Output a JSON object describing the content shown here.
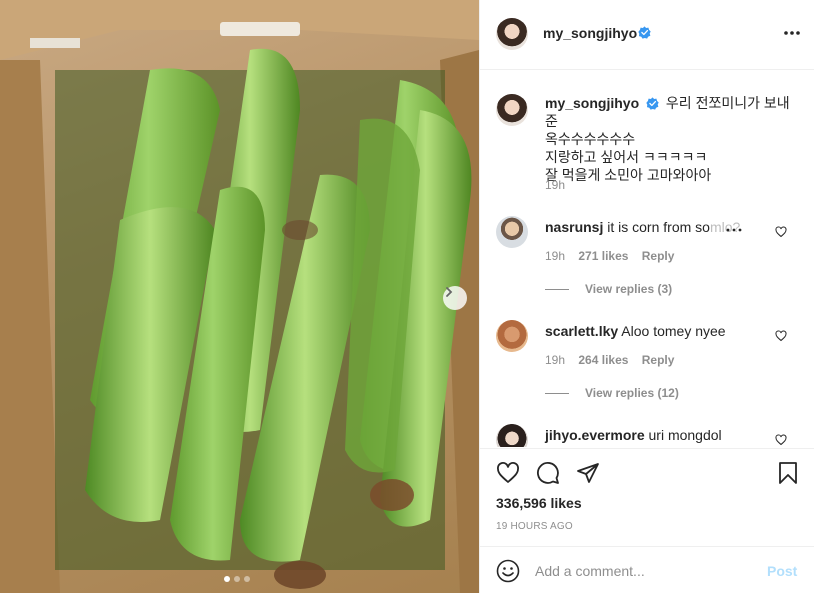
{
  "post": {
    "author": "my_songjihyo",
    "verified": true,
    "caption_lines": [
      "우리 전쪼미니가 보내준",
      "옥수수수수수수",
      "지랑하고 싶어서 ㅋㅋㅋㅋㅋ",
      "잘 먹을게 소민아 고마와아아"
    ],
    "caption_time": "19h",
    "likes": "336,596 likes",
    "posted": "19 HOURS AGO",
    "carousel": {
      "slides": 3,
      "active_slide": 1
    }
  },
  "comments": [
    {
      "username": "nasrunsj",
      "text": "it is corn from so",
      "text_faded": "mlo?",
      "time": "19h",
      "likes": "271 likes",
      "reply": "Reply",
      "view_replies": "View replies (3)"
    },
    {
      "username": "scarlett.lky",
      "text": "Aloo tomey nyee",
      "time": "19h",
      "likes": "264 likes",
      "reply": "Reply",
      "view_replies": "View replies (12)"
    },
    {
      "username": "jihyo.evermore",
      "text": "uri mongdol"
    }
  ],
  "comment_box": {
    "placeholder": "Add a comment...",
    "post_label": "Post"
  },
  "icons": {
    "verified": "verified-badge-icon",
    "more": "more-options-icon",
    "next": "chevron-right-icon",
    "like": "heart-icon",
    "comment": "comment-bubble-icon",
    "share": "paper-plane-icon",
    "save": "bookmark-icon",
    "emoji": "smiley-icon",
    "comment_options": "ellipsis-icon"
  },
  "colors": {
    "verified": "#3897f0",
    "post_disabled": "#b2dffc",
    "muted": "#8e8e8e",
    "text": "#262626"
  }
}
